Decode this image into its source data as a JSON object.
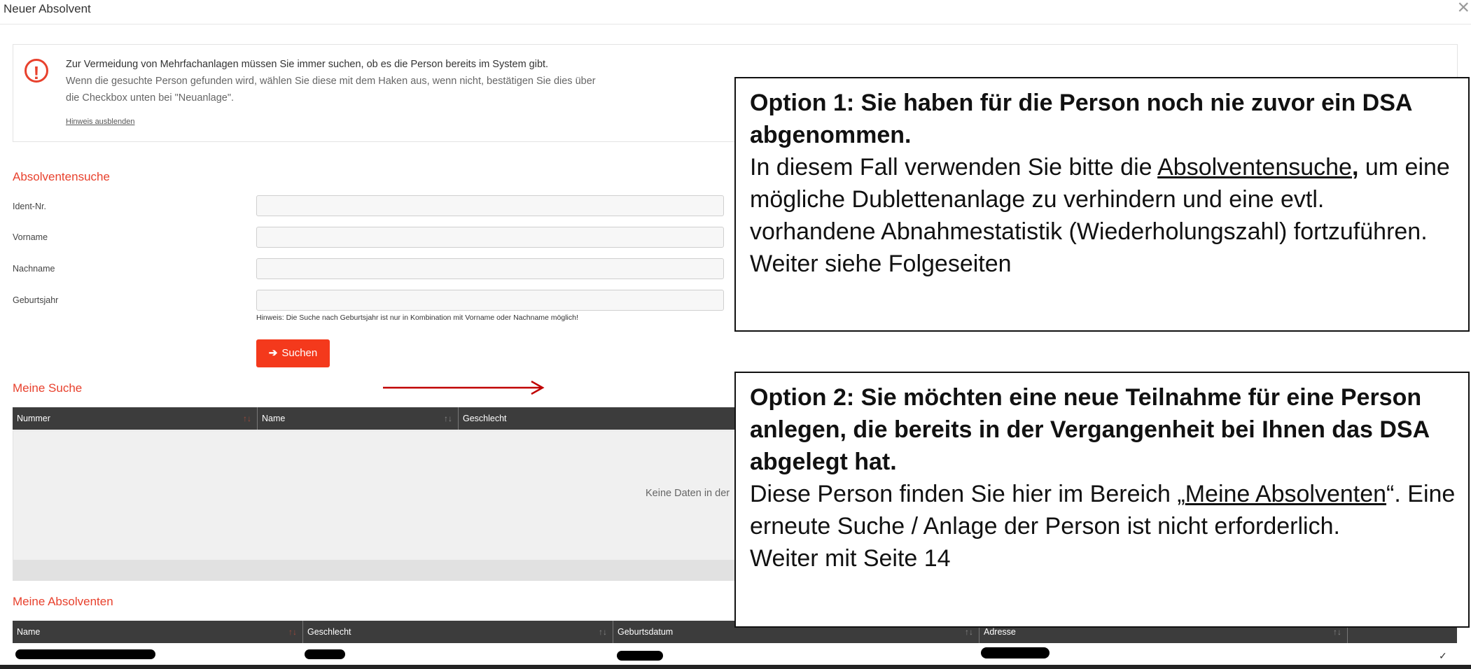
{
  "window": {
    "title": "Neuer Absolvent",
    "close_icon": "close-icon"
  },
  "hint": {
    "line1": "Zur Vermeidung von Mehrfachanlagen müssen Sie immer suchen, ob es die Person bereits im System gibt.",
    "line2": "Wenn die gesuchte Person gefunden wird, wählen Sie diese mit dem Haken aus, wenn nicht, bestätigen Sie dies über",
    "line3": "die Checkbox unten bei \"Neuanlage\".",
    "hide_link": "Hinweis ausblenden",
    "icon": "!"
  },
  "search": {
    "title": "Absolventensuche",
    "labels": {
      "ident": "Ident-Nr.",
      "vorname": "Vorname",
      "nachname": "Nachname",
      "geburtsjahr": "Geburtsjahr"
    },
    "hint": "Hinweis: Die Suche nach Geburtsjahr ist nur in Kombination mit Vorname oder Nachname möglich!",
    "button_label": "Suchen",
    "button_icon": "➔"
  },
  "meine_suche": {
    "title": "Meine Suche",
    "columns": [
      "Nummer",
      "Name",
      "Geschlecht"
    ],
    "sort_icon": "↑↓",
    "empty_text": "Keine Daten in der"
  },
  "meine_absolventen": {
    "title": "Meine Absolventen",
    "columns": [
      "Name",
      "Geschlecht",
      "Geburtsdatum",
      "Adresse"
    ],
    "sort_icon": "↑↓",
    "row_check": "✓"
  },
  "callouts": {
    "option1": {
      "heading": "Option 1: Sie haben für die Person noch nie zuvor ein DSA abgenommen.",
      "text_before": "In diesem Fall verwenden Sie bitte die ",
      "link": "Absolventensuche",
      "comma": ",",
      "text_after": " um eine mögliche Dublettenanlage zu verhindern und eine evtl. vorhandene Abnahmestatistik (Wiederholungszahl) fortzuführen.",
      "footer": "Weiter siehe Folgeseiten"
    },
    "option2": {
      "heading": "Option 2: Sie möchten eine neue Teilnahme für eine Person anlegen, die bereits in der Vergangenheit bei Ihnen das DSA abgelegt hat.",
      "text_before": "Diese Person finden Sie hier im Bereich „",
      "link": "Meine Absolventen",
      "text_after": "“. Eine erneute Suche / Anlage der Person ist nicht erforderlich.",
      "footer": "Weiter mit Seite 14"
    }
  },
  "colors": {
    "accent": "#e8412d",
    "button": "#f4391c",
    "table_header": "#3c3c3c",
    "arrow": "#c00000"
  }
}
